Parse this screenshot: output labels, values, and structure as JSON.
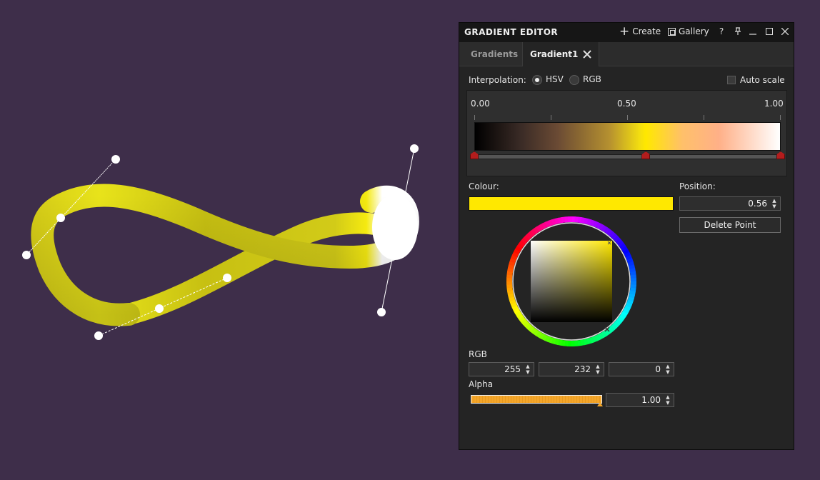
{
  "viewport": {
    "scene": "yellow-curve-tube-with-bezier-handles"
  },
  "panel": {
    "title": "GRADIENT EDITOR",
    "create_label": "Create",
    "gallery_label": "Gallery",
    "help_label": "?",
    "tabs": [
      {
        "label": "Gradients",
        "active": false
      },
      {
        "label": "Gradient1",
        "active": true
      }
    ],
    "interpolation_label": "Interpolation:",
    "interp_hsv": "HSV",
    "interp_rgb": "RGB",
    "interp_selected": "HSV",
    "auto_scale_label": "Auto scale",
    "auto_scale_checked": false,
    "scale_labels": [
      "0.00",
      "0.50",
      "1.00"
    ],
    "gradient_stops": [
      {
        "position": 0.0,
        "color": "#000000"
      },
      {
        "position": 0.56,
        "color": "#ffe800"
      },
      {
        "position": 1.0,
        "color": "#ffffff"
      }
    ],
    "colour_label": "Colour:",
    "current_colour": "#ffe800",
    "position_label": "Position:",
    "position_value": "0.56",
    "delete_point_label": "Delete Point",
    "rgb_label": "RGB",
    "rgb_values": [
      "255",
      "232",
      "0"
    ],
    "alpha_label": "Alpha",
    "alpha_value": "1.00",
    "alpha_fraction": 1.0
  }
}
